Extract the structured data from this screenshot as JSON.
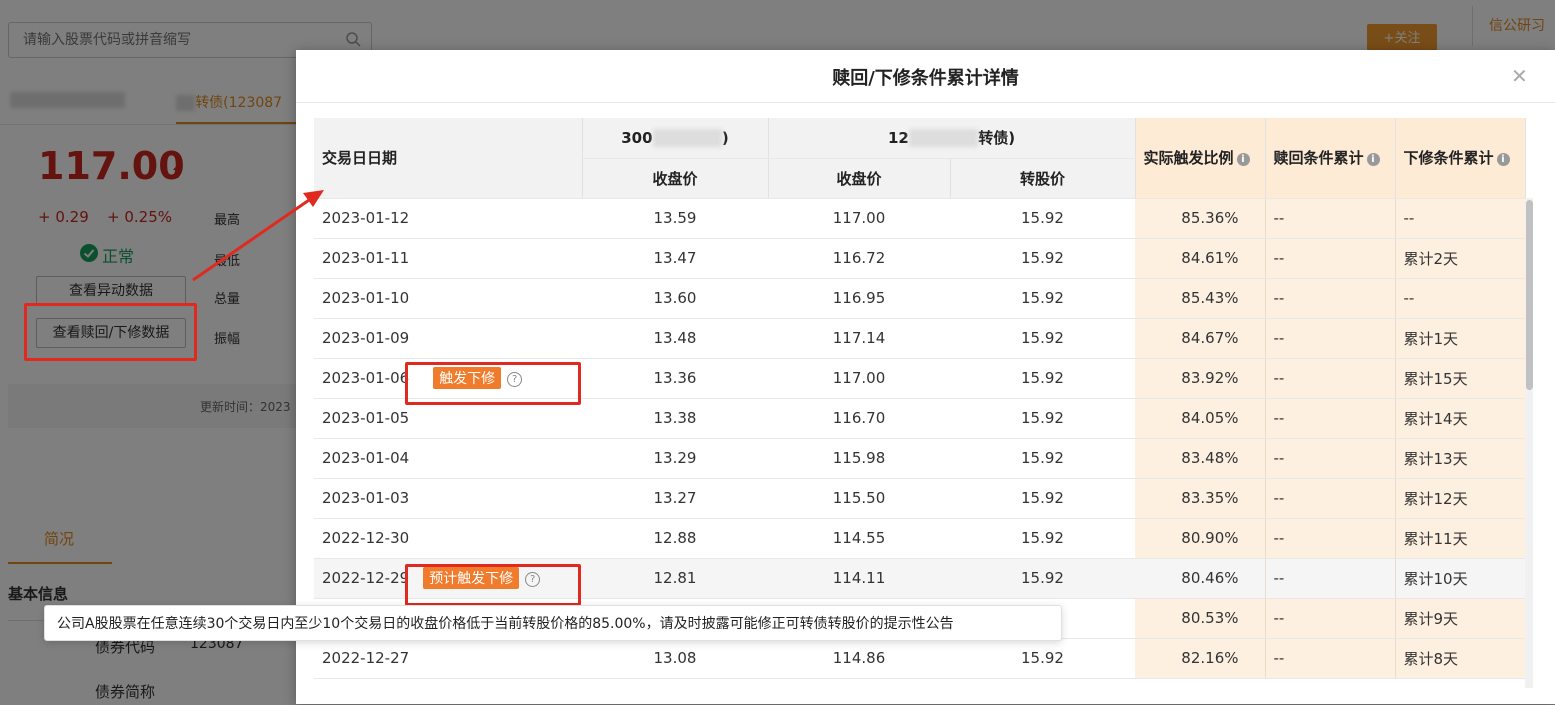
{
  "search": {
    "placeholder": "请输入股票代码或拼音缩写"
  },
  "header": {
    "follow_label": "+关注",
    "right_tab": "信公研习"
  },
  "stock_tabs": {
    "tab1": "",
    "tab2": "转债(123087"
  },
  "quote": {
    "price": "117.00",
    "arrow": "⬆",
    "change_abs": "+ 0.29",
    "change_pct": "+ 0.25%",
    "labels": {
      "high": "最高",
      "low": "最低",
      "volume": "总量",
      "amplitude": "振幅"
    },
    "status": "正常"
  },
  "buttons": {
    "abnormal": "查看异动数据",
    "redeem_reset": "查看赎回/下修数据"
  },
  "update_time": "更新时间：2023",
  "section": {
    "intro_tab": "简况",
    "basic_info": "基本信息"
  },
  "basic_rows": [
    {
      "key": "债券代码",
      "value": "123087"
    },
    {
      "key": "债券简称",
      "value": ""
    }
  ],
  "modal": {
    "title": "赎回/下修条件累计详情",
    "headers": {
      "trade_date": "交易日日期",
      "stock_group": "300",
      "stock_group_suffix": ")",
      "bond_group": "12",
      "bond_group_suffix": "转债)",
      "stock_close": "收盘价",
      "bond_close": "收盘价",
      "conv_price": "转股价",
      "ratio": "实际触发比例",
      "redeem": "赎回条件累计",
      "reset": "下修条件累计"
    },
    "tooltip": "公司A股股票在任意连续30个交易日内至少10个交易日的收盘价格低于当前转股价格的85.00%，请及时披露可能修正可转债转股价的提示性公告",
    "rows": [
      {
        "date": "2023-01-12",
        "tag": "",
        "stock": "13.59",
        "bond": "117.00",
        "conv": "15.92",
        "ratio": "85.36%",
        "redeem": "--",
        "reset": "--"
      },
      {
        "date": "2023-01-11",
        "tag": "",
        "stock": "13.47",
        "bond": "116.72",
        "conv": "15.92",
        "ratio": "84.61%",
        "redeem": "--",
        "reset": "累计2天"
      },
      {
        "date": "2023-01-10",
        "tag": "",
        "stock": "13.60",
        "bond": "116.95",
        "conv": "15.92",
        "ratio": "85.43%",
        "redeem": "--",
        "reset": "--"
      },
      {
        "date": "2023-01-09",
        "tag": "",
        "stock": "13.48",
        "bond": "117.14",
        "conv": "15.92",
        "ratio": "84.67%",
        "redeem": "--",
        "reset": "累计1天"
      },
      {
        "date": "2023-01-06",
        "tag": "触发下修",
        "stock": "13.36",
        "bond": "117.00",
        "conv": "15.92",
        "ratio": "83.92%",
        "redeem": "--",
        "reset": "累计15天"
      },
      {
        "date": "2023-01-05",
        "tag": "",
        "stock": "13.38",
        "bond": "116.70",
        "conv": "15.92",
        "ratio": "84.05%",
        "redeem": "--",
        "reset": "累计14天"
      },
      {
        "date": "2023-01-04",
        "tag": "",
        "stock": "13.29",
        "bond": "115.98",
        "conv": "15.92",
        "ratio": "83.48%",
        "redeem": "--",
        "reset": "累计13天"
      },
      {
        "date": "2023-01-03",
        "tag": "",
        "stock": "13.27",
        "bond": "115.50",
        "conv": "15.92",
        "ratio": "83.35%",
        "redeem": "--",
        "reset": "累计12天"
      },
      {
        "date": "2022-12-30",
        "tag": "",
        "stock": "12.88",
        "bond": "114.55",
        "conv": "15.92",
        "ratio": "80.90%",
        "redeem": "--",
        "reset": "累计11天"
      },
      {
        "date": "2022-12-29",
        "tag": "预计触发下修",
        "stock": "12.81",
        "bond": "114.11",
        "conv": "15.92",
        "ratio": "80.46%",
        "redeem": "--",
        "reset": "累计10天"
      },
      {
        "date": "",
        "tag": "",
        "stock": "",
        "bond": "",
        "conv": "",
        "ratio": "80.53%",
        "redeem": "--",
        "reset": "累计9天"
      },
      {
        "date": "2022-12-27",
        "tag": "",
        "stock": "13.08",
        "bond": "114.86",
        "conv": "15.92",
        "ratio": "82.16%",
        "redeem": "--",
        "reset": "累计8天"
      }
    ]
  }
}
